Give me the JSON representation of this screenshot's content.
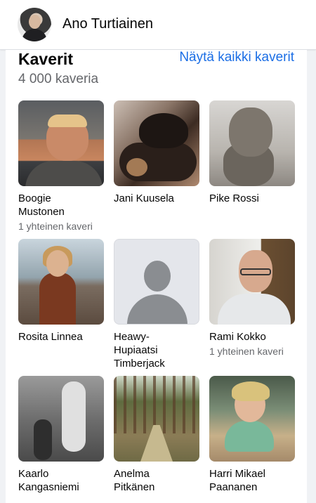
{
  "header": {
    "profile_name": "Ano Turtiainen"
  },
  "friends_section": {
    "title": "Kaverit",
    "see_all": "Näytä kaikki kaverit",
    "count": "4 000 kaveria",
    "friends": [
      {
        "name_line1": "Boogie",
        "name_line2": "Mustonen",
        "mutual": "1 yhteinen kaveri"
      },
      {
        "name_line1": "Jani Kuusela",
        "name_line2": "",
        "mutual": ""
      },
      {
        "name_line1": "Pike Rossi",
        "name_line2": "",
        "mutual": ""
      },
      {
        "name_line1": "Rosita Linnea",
        "name_line2": "",
        "mutual": ""
      },
      {
        "name_line1": "Heawy-",
        "name_line2": "Hupiaatsi",
        "name_line3": "Timberjack",
        "mutual": ""
      },
      {
        "name_line1": "Rami Kokko",
        "name_line2": "",
        "mutual": "1 yhteinen kaveri"
      },
      {
        "name_line1": "Kaarlo",
        "name_line2": "Kangasniemi",
        "mutual": ""
      },
      {
        "name_line1": "Anelma",
        "name_line2": "Pitkänen",
        "mutual": ""
      },
      {
        "name_line1": "Harri Mikael",
        "name_line2": "Paananen",
        "mutual": ""
      }
    ]
  },
  "colors": {
    "link": "#1b6ee5",
    "secondary_text": "#65676b",
    "background": "#f0f2f5"
  }
}
